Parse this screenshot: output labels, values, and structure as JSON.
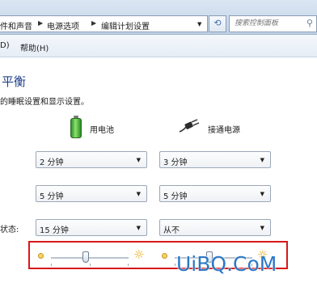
{
  "breadcrumb": {
    "items": [
      "件和声音",
      "电源选项",
      "编辑计划设置"
    ]
  },
  "search": {
    "placeholder": "搜索控制面板"
  },
  "menu": {
    "items": [
      "D)",
      "帮助(H)"
    ]
  },
  "page": {
    "title": "平衡",
    "description": "的睡眠设置和显示设置。"
  },
  "columns": {
    "battery": "用电池",
    "plugged": "接通电源"
  },
  "rows": [
    {
      "label": "",
      "battery": "2 分钟",
      "plugged": "3 分钟"
    },
    {
      "label": "",
      "battery": "5 分钟",
      "plugged": "5 分钟"
    },
    {
      "label": "状态:",
      "battery": "15 分钟",
      "plugged": "从不"
    }
  ],
  "brightness": {
    "battery_level": 0.45,
    "plugged_level": 0.45
  },
  "watermark": "UiBQ.CoM",
  "colors": {
    "accent": "#1f3f8a",
    "highlight": "#d71818",
    "watermark": "#2b78c6"
  }
}
